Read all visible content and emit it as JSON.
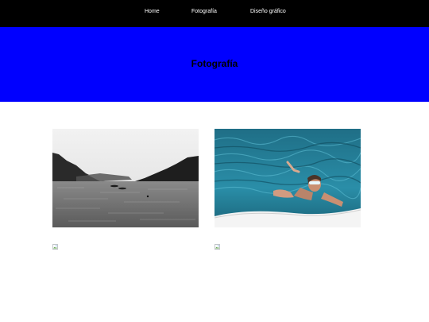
{
  "nav": {
    "items": [
      {
        "label": "Home"
      },
      {
        "label": "Fotografía"
      },
      {
        "label": "Diseño gráfico"
      }
    ]
  },
  "hero": {
    "title": "Fotografía",
    "background": "#0000ff"
  },
  "gallery": {
    "photos": [
      {
        "icon": "lake-landscape-photo"
      },
      {
        "icon": "swimmer-in-sea-photo"
      },
      {
        "icon": "broken-image-icon"
      },
      {
        "icon": "broken-image-icon"
      }
    ]
  },
  "colors": {
    "navbar": "#000000",
    "hero": "#0000ff",
    "page": "#ffffff"
  }
}
